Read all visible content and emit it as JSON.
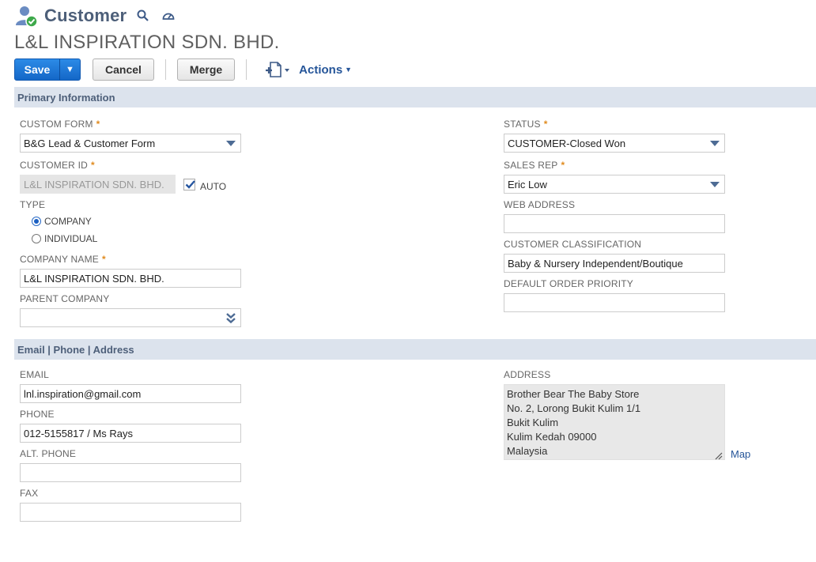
{
  "header": {
    "page_type": "Customer",
    "entity_name": "L&L INSPIRATION SDN. BHD."
  },
  "toolbar": {
    "save_label": "Save",
    "save_menu_arrow": "▼",
    "cancel_label": "Cancel",
    "merge_label": "Merge",
    "actions_label": "Actions"
  },
  "sections": {
    "primary": "Primary Information",
    "contact": "Email | Phone | Address"
  },
  "primary": {
    "custom_form": {
      "label": "CUSTOM FORM",
      "value": "B&G Lead & Customer Form"
    },
    "customer_id": {
      "label": "CUSTOMER ID",
      "value": "L&L INSPIRATION SDN. BHD.",
      "auto_label": "AUTO",
      "auto_checked": true
    },
    "type": {
      "label": "TYPE",
      "options": [
        "COMPANY",
        "INDIVIDUAL"
      ],
      "selected": "COMPANY"
    },
    "company_name": {
      "label": "COMPANY NAME",
      "value": "L&L INSPIRATION SDN. BHD."
    },
    "parent_company": {
      "label": "PARENT COMPANY",
      "value": ""
    },
    "status": {
      "label": "STATUS",
      "value": "CUSTOMER-Closed Won"
    },
    "sales_rep": {
      "label": "SALES REP",
      "value": "Eric Low"
    },
    "web_address": {
      "label": "WEB ADDRESS",
      "value": ""
    },
    "customer_classification": {
      "label": "CUSTOMER CLASSIFICATION",
      "value": "Baby & Nursery Independent/Boutique"
    },
    "default_order_priority": {
      "label": "DEFAULT ORDER PRIORITY",
      "value": ""
    }
  },
  "contact": {
    "email": {
      "label": "EMAIL",
      "value": "lnl.inspiration@gmail.com"
    },
    "phone": {
      "label": "PHONE",
      "value": "012-5155817 / Ms Rays"
    },
    "alt_phone": {
      "label": "ALT. PHONE",
      "value": ""
    },
    "fax": {
      "label": "FAX",
      "value": ""
    },
    "address": {
      "label": "ADDRESS",
      "lines": [
        "Brother Bear The Baby Store",
        "No. 2, Lorong Bukit Kulim 1/1",
        "Bukit Kulim",
        "Kulim Kedah 09000",
        "Malaysia"
      ],
      "map_label": "Map"
    }
  },
  "colors": {
    "accent": "#255599",
    "section_bar": "#dce3ed",
    "required": "#e08b1f",
    "save_button": "#1a73e8"
  },
  "icons": {
    "record": "customer-check-icon",
    "search": "search-icon",
    "dashboard": "dashboard-icon",
    "new_record": "new-document-icon"
  }
}
